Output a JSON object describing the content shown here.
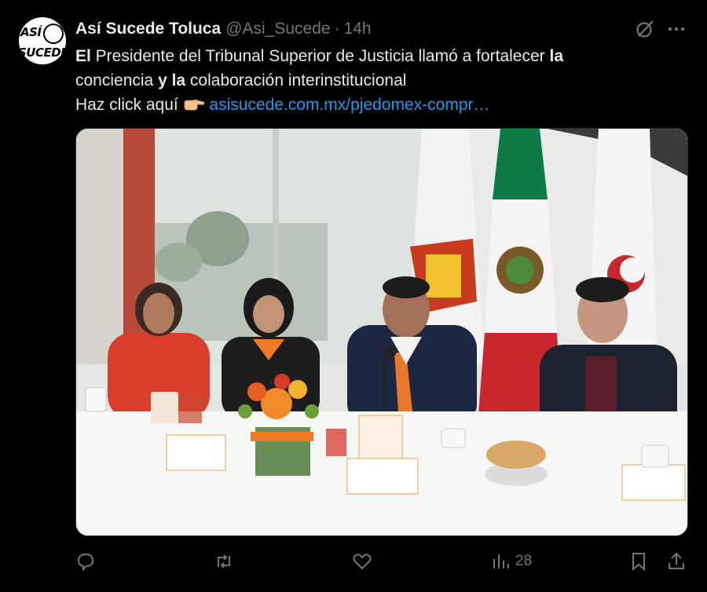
{
  "tweet": {
    "author_name": "Así Sucede Toluca",
    "handle": "@Asi_Sucede",
    "separator": "·",
    "time": "14h",
    "avatar_line1": "ASÍ",
    "avatar_line2": "SUCEDE",
    "text_part1": "El",
    "text_part2": " Presidente del Tribunal Superior de Justicia llamó a fortalecer ",
    "text_part3": "la",
    "text_part4": "conciencia ",
    "text_part5": "y la",
    "text_part6": " colaboración interinstitucional",
    "text_part7": "Haz click aquí ",
    "link": "asisucede.com.mx/pjedomex-compr…",
    "emoji": "backhand-index-pointing-right"
  },
  "media": {
    "photo_description_icons": [
      "flag-estado-de-mexico",
      "flag-mexico",
      "flag-pj-edomex",
      "flower-arrangement"
    ]
  },
  "actions": {
    "views_count": "28"
  },
  "colors": {
    "background": "#000000",
    "text": "#e7e9ea",
    "muted": "#71767b",
    "link": "#1d9bf0"
  }
}
